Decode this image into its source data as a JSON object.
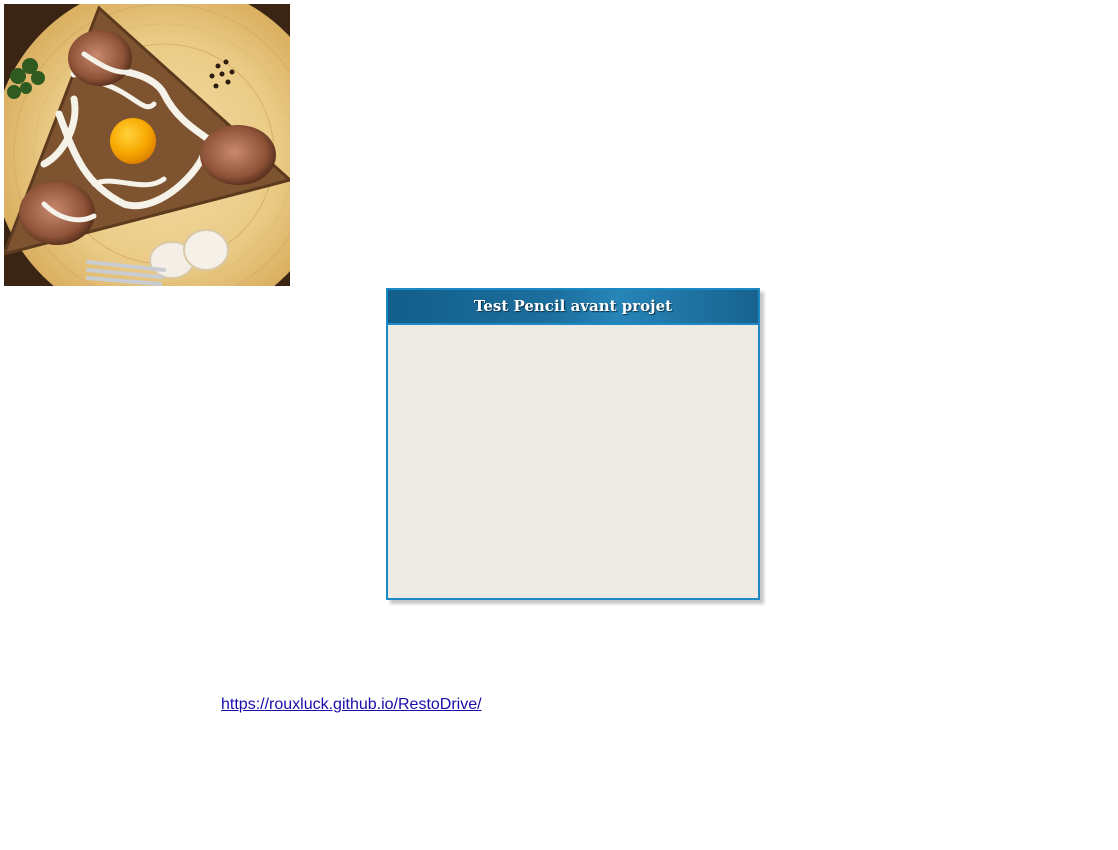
{
  "panel": {
    "title": "Test Pencil avant projet"
  },
  "link": {
    "text": "https://rouxluck.github.io/RestoDrive/"
  },
  "colors": {
    "panel_border": "#1c88c4",
    "panel_header": "#135e8a",
    "panel_body": "#ede9e3",
    "link": "#1a0dab"
  }
}
